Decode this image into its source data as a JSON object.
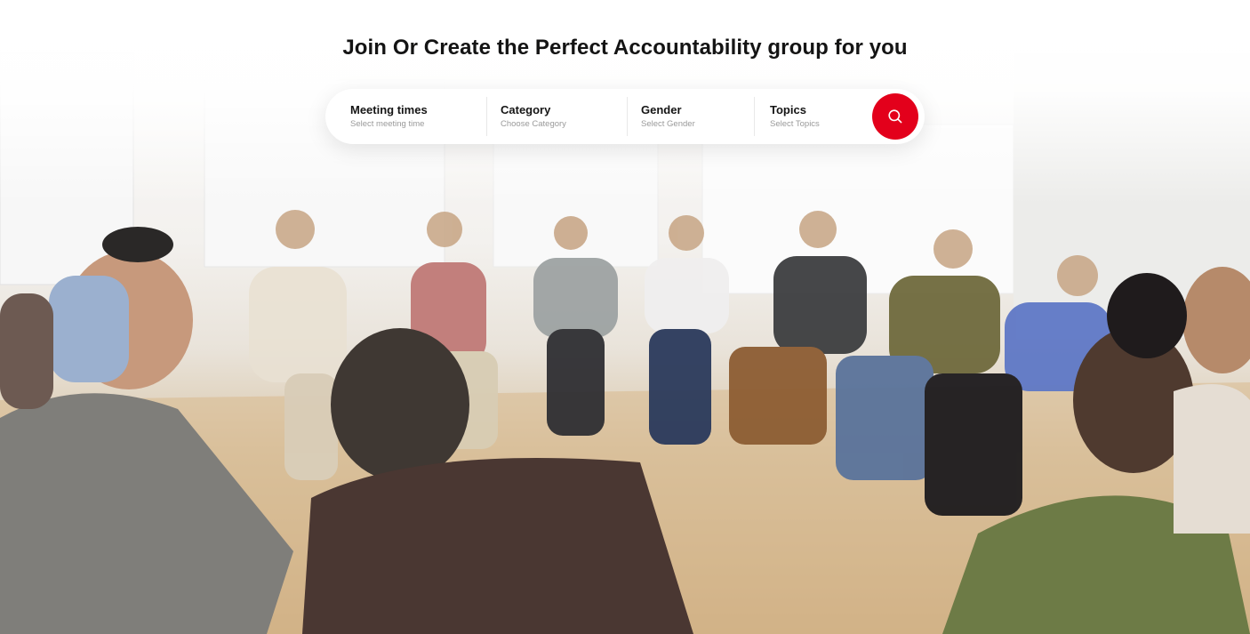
{
  "page": {
    "title": "Join Or Create the Perfect Accountability group for you"
  },
  "search": {
    "filters": [
      {
        "label": "Meeting times",
        "placeholder": "Select meeting time"
      },
      {
        "label": "Category",
        "placeholder": "Choose Category"
      },
      {
        "label": "Gender",
        "placeholder": "Select Gender"
      },
      {
        "label": "Topics",
        "placeholder": "Select Topics"
      }
    ],
    "button_icon": "search-icon"
  },
  "colors": {
    "accent": "#e3001b",
    "title": "#141414",
    "placeholder": "#9a9a9a"
  },
  "background": {
    "image": "photo of people sitting in a circle in a bright room"
  }
}
